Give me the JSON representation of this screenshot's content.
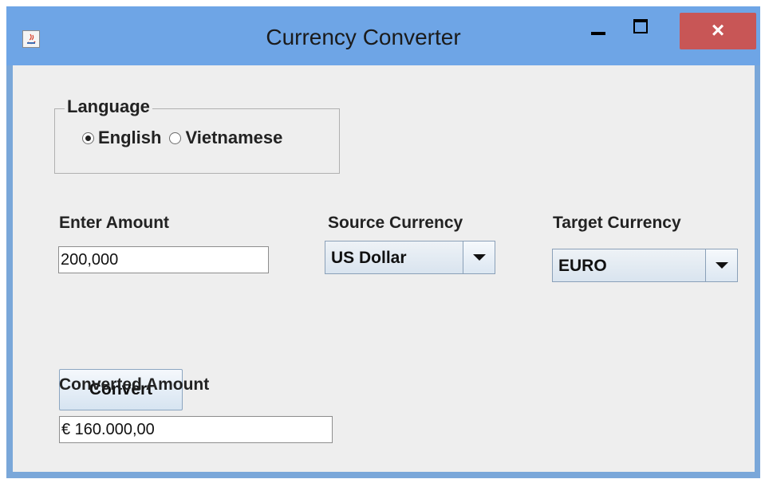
{
  "window": {
    "title": "Currency Converter",
    "close_glyph": "×",
    "icons": [
      "java-app-icon",
      "minimize-icon",
      "maximize-icon",
      "close-icon"
    ]
  },
  "language": {
    "group_label": "Language",
    "options": [
      {
        "label": "English",
        "selected": true
      },
      {
        "label": "Vietnamese",
        "selected": false
      }
    ]
  },
  "amount": {
    "label": "Enter Amount",
    "value": "200,000"
  },
  "source_currency": {
    "label": "Source Currency",
    "selected": "US Dollar"
  },
  "target_currency": {
    "label": "Target Currency",
    "selected": "EURO"
  },
  "actions": {
    "convert_label": "Convert"
  },
  "result": {
    "label": "Converted Amount",
    "value": "€ 160.000,00"
  },
  "colors": {
    "titlebar": "#6ea5e6",
    "close_button": "#c85656",
    "panel": "#eeeeee"
  }
}
